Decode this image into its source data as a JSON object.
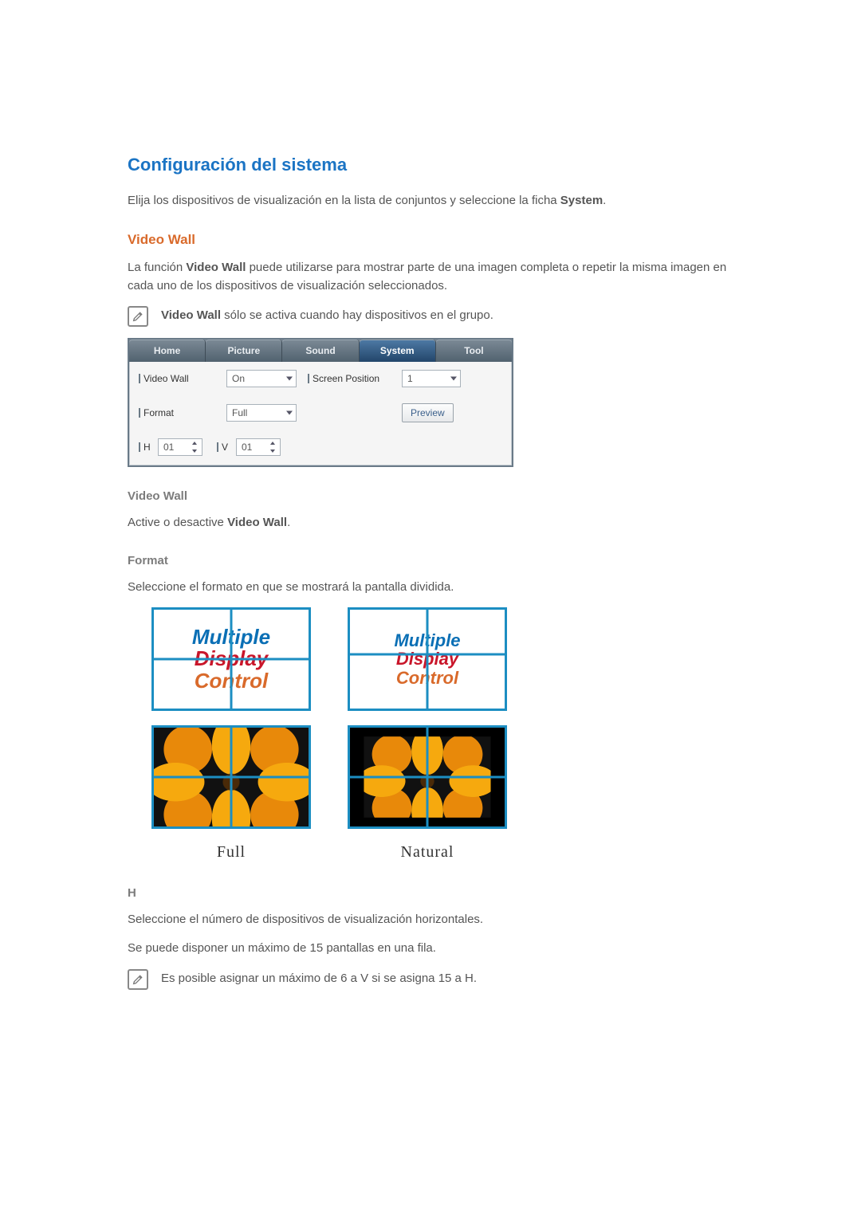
{
  "title": "Configuración del sistema",
  "intro_prefix": "Elija los dispositivos de visualización en la lista de conjuntos y seleccione la ficha ",
  "intro_bold": "System",
  "intro_suffix": ".",
  "video_wall": {
    "heading": "Video Wall",
    "desc_prefix": "La función ",
    "desc_bold": "Video Wall",
    "desc_suffix": " puede utilizarse para mostrar parte de una imagen completa o repetir la misma imagen en cada uno de los dispositivos de visualización seleccionados.",
    "note_bold": "Video Wall",
    "note_rest": " sólo se activa cuando hay dispositivos en el grupo."
  },
  "panel": {
    "tabs": [
      "Home",
      "Picture",
      "Sound",
      "System",
      "Tool"
    ],
    "active_tab_index": 3,
    "labels": {
      "video_wall": "Video Wall",
      "screen_position": "Screen Position",
      "format": "Format",
      "h": "H",
      "v": "V"
    },
    "values": {
      "video_wall": "On",
      "screen_position": "1",
      "format": "Full",
      "h": "01",
      "v": "01"
    },
    "preview_btn": "Preview"
  },
  "sections": {
    "vw_title": "Video Wall",
    "vw_text_prefix": "Active o desactive ",
    "vw_text_bold": "Video Wall",
    "vw_text_suffix": ".",
    "format_title": "Format",
    "format_text": "Seleccione el formato en que se mostrará la pantalla dividida.",
    "caption_full": "Full",
    "caption_natural": "Natural",
    "mdc_line1": "Multiple",
    "mdc_line2": "Display",
    "mdc_line3": "Control",
    "h_title": "H",
    "h_text1": "Seleccione el número de dispositivos de visualización horizontales.",
    "h_text2": "Se puede disponer un máximo de 15 pantallas en una fila.",
    "h_note": "Es posible asignar un máximo de 6 a V si se asigna 15 a H."
  }
}
